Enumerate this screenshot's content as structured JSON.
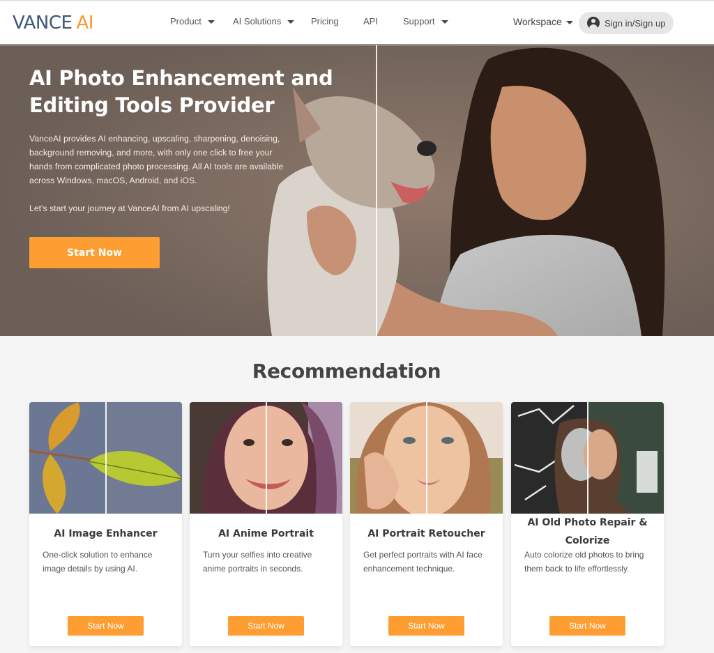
{
  "header": {
    "logo": {
      "primary": "VANCE",
      "accent": "AI"
    },
    "nav": [
      {
        "label": "Product",
        "has_dropdown": true
      },
      {
        "label": "AI Solutions",
        "has_dropdown": true
      },
      {
        "label": "Pricing",
        "has_dropdown": false
      },
      {
        "label": "API",
        "has_dropdown": false
      },
      {
        "label": "Support",
        "has_dropdown": true
      }
    ],
    "workspace_label": "Workspace",
    "signin_label": "Sign in/Sign up",
    "signin_icon": "user-circle-icon"
  },
  "hero": {
    "title": "AI Photo Enhancement and Editing Tools Provider",
    "description": "VanceAI provides AI enhancing, upscaling, sharpening, denoising, background removing, and more, with only one click to free your hands from complicated photo processing. All AI tools are available across Windows, macOS, Android, and iOS.",
    "subtext": "Let's start your journey at VanceAI from AI upscaling!",
    "cta_label": "Start Now",
    "image_alt": "Woman holding dog, before/after comparison"
  },
  "recommendation": {
    "title": "Recommendation",
    "cards": [
      {
        "title": "AI Image Enhancer",
        "description": "One-click solution to enhance image details by using AI.",
        "button": "Start Now",
        "image": "leaf before/after"
      },
      {
        "title": "AI Anime Portrait",
        "description": "Turn your selfies into creative anime portraits in seconds.",
        "button": "Start Now",
        "image": "selfie to anime before/after"
      },
      {
        "title": "AI Portrait Retoucher",
        "description": "Get perfect portraits with AI face enhancement technique.",
        "button": "Start Now",
        "image": "portrait retouch before/after"
      },
      {
        "title": "AI Old Photo Repair & Colorize",
        "description": "Auto colorize old photos to bring them back to life effortlessly.",
        "button": "Start Now",
        "image": "old photo colorize before/after"
      }
    ]
  },
  "colors": {
    "brand_blue": "#3d5578",
    "brand_orange": "#f59a2c",
    "button_orange": "#fd9d32",
    "page_bg": "#f5f5f5"
  }
}
